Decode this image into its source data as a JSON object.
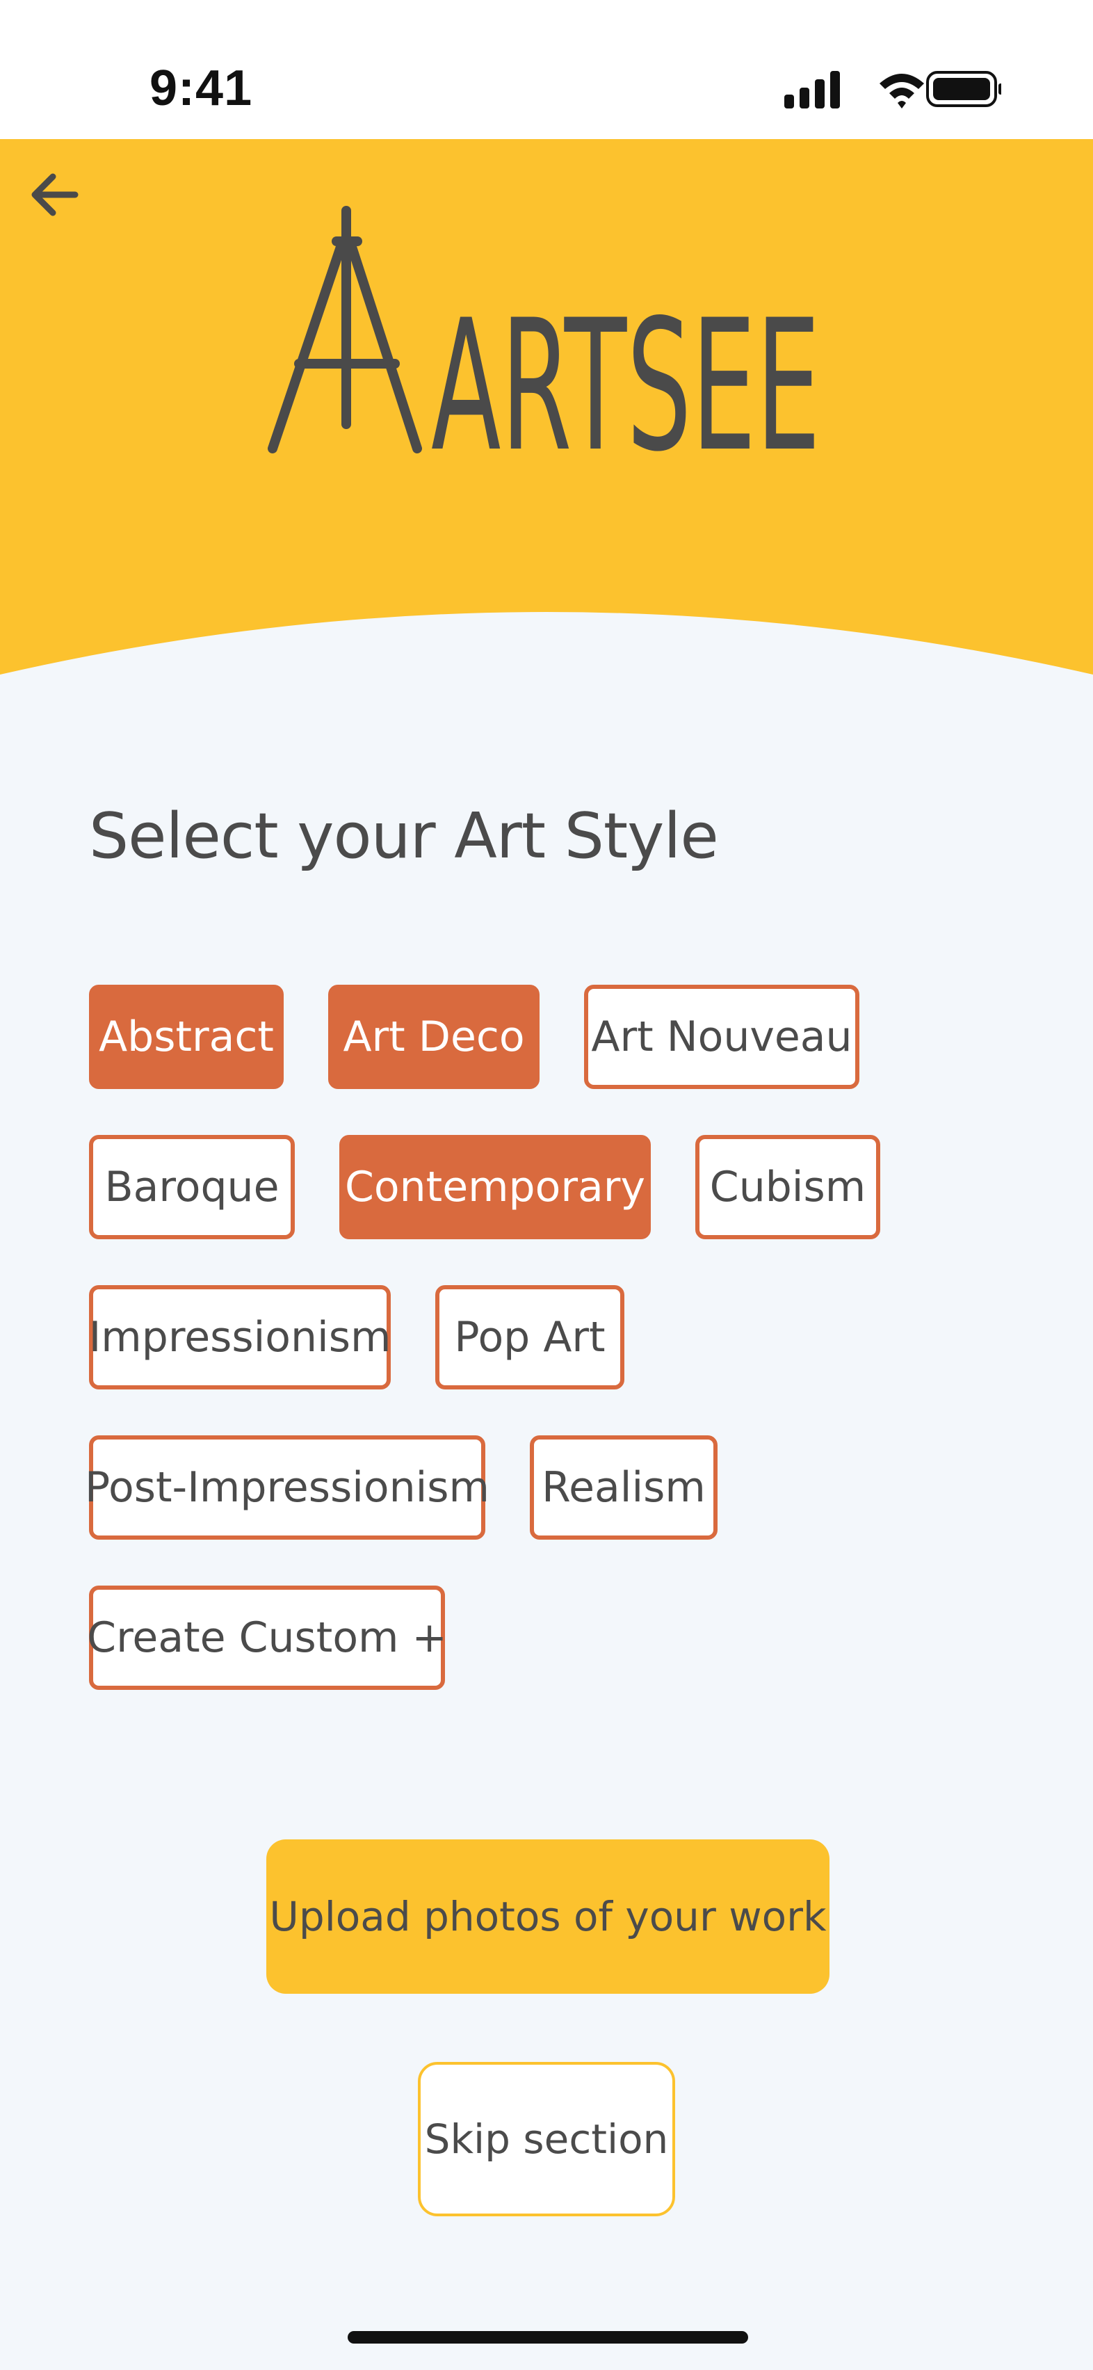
{
  "status_bar": {
    "time": "9:41"
  },
  "header": {
    "brand": "ARTSEE",
    "background_color": "#FCC22E"
  },
  "main": {
    "title": "Select your Art Style",
    "styles": [
      {
        "label": "Abstract",
        "selected": true
      },
      {
        "label": "Art Deco",
        "selected": true
      },
      {
        "label": "Art Nouveau",
        "selected": false
      },
      {
        "label": "Baroque",
        "selected": false
      },
      {
        "label": "Contemporary",
        "selected": true
      },
      {
        "label": "Cubism",
        "selected": false
      },
      {
        "label": "Impressionism",
        "selected": false
      },
      {
        "label": "Pop Art",
        "selected": false
      },
      {
        "label": "Post-Impressionism",
        "selected": false
      },
      {
        "label": "Realism",
        "selected": false
      },
      {
        "label": "Create Custom +",
        "selected": false
      }
    ],
    "accent_color": "#D96A3E"
  },
  "actions": {
    "upload_label": "Upload photos of your work",
    "skip_label": "Skip section"
  },
  "icons": [
    "back-arrow-icon",
    "signal-icon",
    "wifi-icon",
    "battery-icon",
    "easel-logo-icon"
  ]
}
